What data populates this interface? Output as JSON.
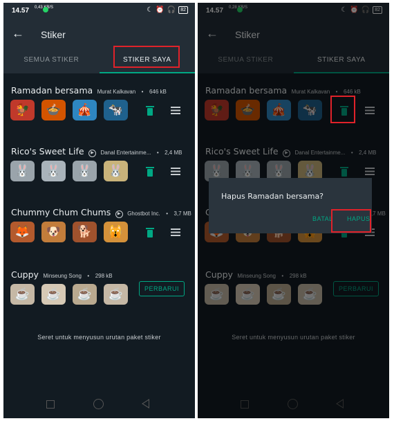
{
  "status": {
    "time": "14.57",
    "speed": "0,43 KB/S",
    "speed_right": "0,28 KB/S",
    "battery": "82"
  },
  "header": {
    "title": "Stiker"
  },
  "tabs": [
    {
      "label": "SEMUA STIKER"
    },
    {
      "label": "STIKER SAYA"
    }
  ],
  "packs": [
    {
      "name": "Ramadan bersama",
      "author": "Murat Kalkavan",
      "size": "646 kB",
      "stickers": [
        "🐓",
        "🍲",
        "🎪",
        "🐄"
      ],
      "colors": [
        "#c0392b",
        "#d35400",
        "#2e86c1",
        "#1f618d"
      ]
    },
    {
      "name": "Rico's Sweet Life",
      "author": "Danal Entertainme...",
      "size": "2,4 MB",
      "stickers": [
        "🐰",
        "🐰",
        "🐰",
        "🐰"
      ],
      "colors": [
        "#9aa4ab",
        "#a9b3ba",
        "#9aa4ab",
        "#c9b37a"
      ]
    },
    {
      "name": "Chummy Chum Chums",
      "author": "Ghostbot Inc.",
      "size": "3,7 MB",
      "stickers": [
        "🦊",
        "🐶",
        "🐕",
        "🙀"
      ],
      "colors": [
        "#b35a2d",
        "#c27d3b",
        "#a0522d",
        "#d4913a"
      ]
    },
    {
      "name": "Cuppy",
      "author": "Minseung Song",
      "size": "298 kB",
      "stickers": [
        "☕",
        "☕",
        "☕",
        "☕"
      ],
      "colors": [
        "#c5b8a5",
        "#d6c9b5",
        "#b9a98f",
        "#c5b8a5"
      ],
      "update_label": "PERBARUI"
    }
  ],
  "hint": "Seret untuk menyusun urutan paket stiker",
  "dialog": {
    "message": "Hapus Ramadan bersama?",
    "cancel": "BATAL",
    "confirm": "HAPUS"
  },
  "colors": {
    "accent": "#00a884",
    "highlight": "#e0222a",
    "background": "#121b22",
    "bar": "#232d36"
  }
}
